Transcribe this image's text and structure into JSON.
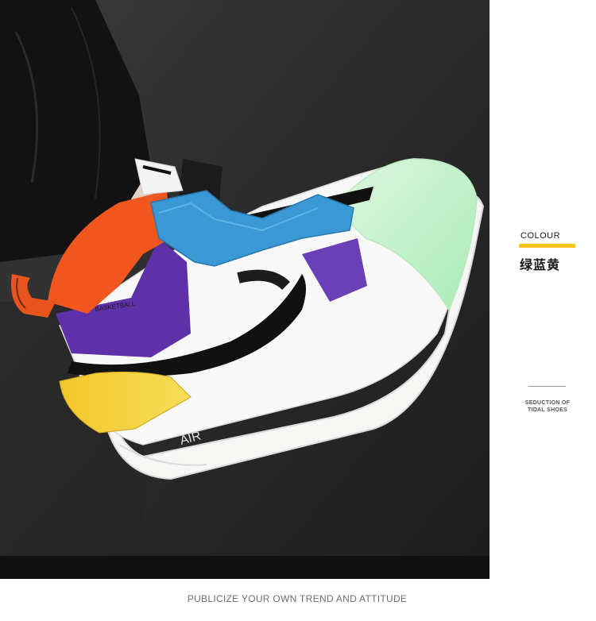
{
  "side_panel": {
    "colour_label": "COLOUR",
    "colour_name": "绿蓝黄",
    "accent_color": "#f7c41c",
    "tagline_line1": "SEDUCTION OF",
    "tagline_line2": "TIDAL SHOES"
  },
  "footer": {
    "caption": "PUBLICIZE YOUR OWN TREND AND ATTITUDE"
  },
  "photo": {
    "subject": "sneaker-photo",
    "heel_text": "BASKETBALL",
    "midsole_text": "AIR"
  }
}
